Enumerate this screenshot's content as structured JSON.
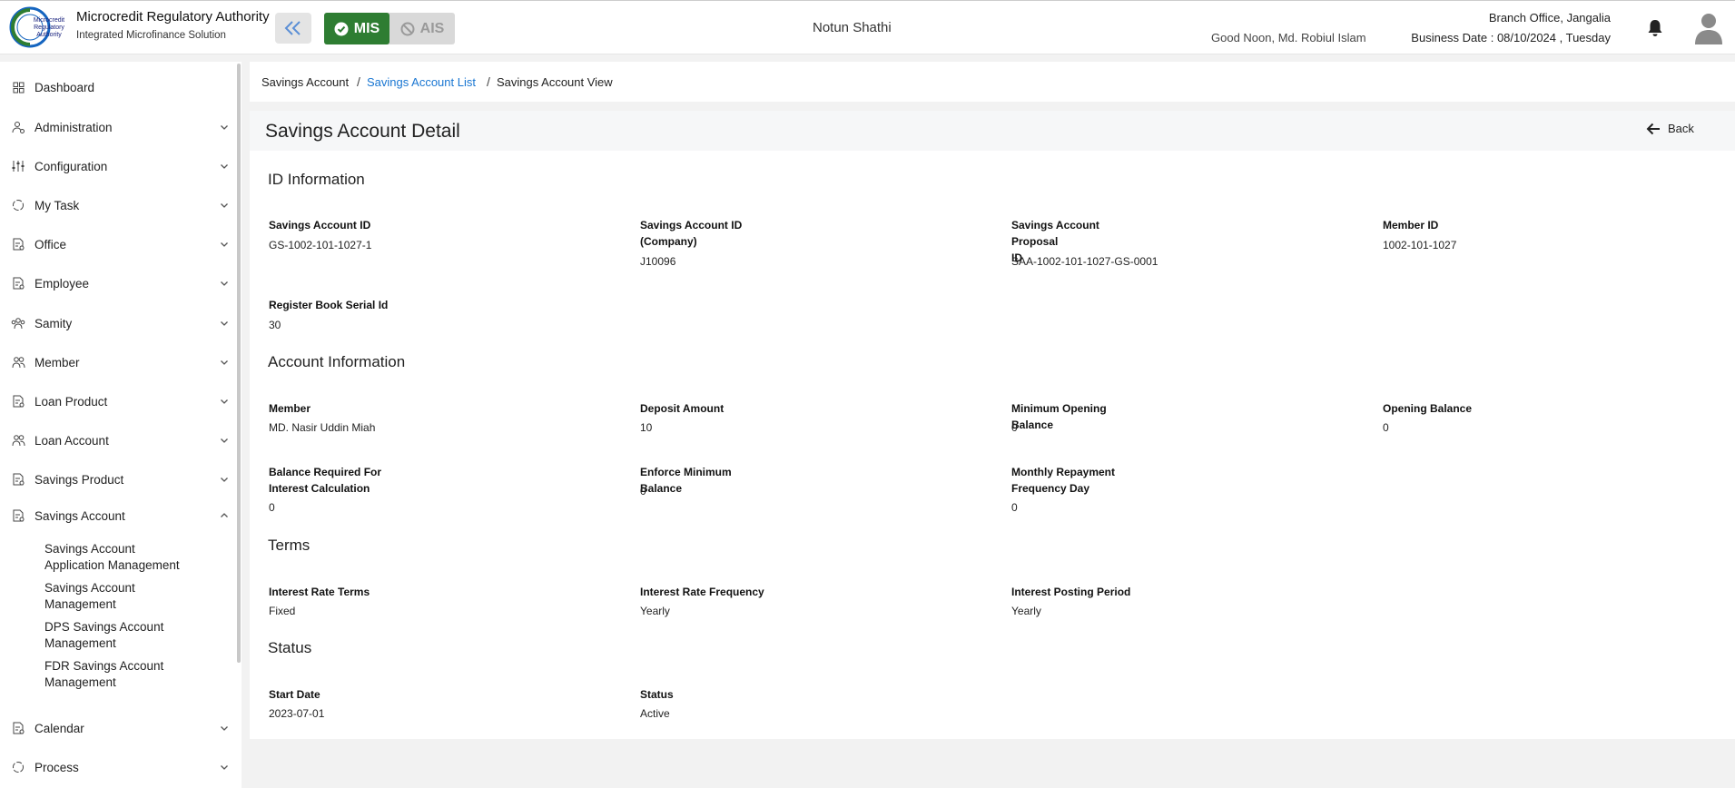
{
  "header": {
    "brand_title": "Microcredit Regulatory Authority",
    "brand_subtitle": "Integrated Microfinance Solution",
    "logo_text": "Microcredit Regulatory Authority",
    "org_name": "Notun Shathi",
    "greeting": "Good Noon, Md. Robiul Islam",
    "branch": "Branch Office, Jangalia",
    "business_date": "Business Date : 08/10/2024 , Tuesday",
    "systems": [
      {
        "label": "MIS",
        "active": true,
        "icon": "check-circle-icon"
      },
      {
        "label": "AIS",
        "active": false,
        "icon": "ban-icon"
      }
    ],
    "colors": {
      "mis_active": "#2e7d32",
      "link": "#1976d2"
    }
  },
  "sidebar": {
    "items": [
      {
        "label": "Dashboard",
        "icon": "grid-icon",
        "expandable": false
      },
      {
        "label": "Administration",
        "icon": "users-cog-icon",
        "expandable": true
      },
      {
        "label": "Configuration",
        "icon": "sliders-icon",
        "expandable": true
      },
      {
        "label": "My Task",
        "icon": "refresh-icon",
        "expandable": true
      },
      {
        "label": "Office",
        "icon": "document-icon",
        "expandable": true
      },
      {
        "label": "Employee",
        "icon": "document-icon",
        "expandable": true
      },
      {
        "label": "Samity",
        "icon": "group-icon",
        "expandable": true
      },
      {
        "label": "Member",
        "icon": "members-icon",
        "expandable": true
      },
      {
        "label": "Loan Product",
        "icon": "document-icon",
        "expandable": true
      },
      {
        "label": "Loan Account",
        "icon": "members-icon",
        "expandable": true
      },
      {
        "label": "Savings Product",
        "icon": "document-icon",
        "expandable": true
      },
      {
        "label": "Savings Account",
        "icon": "document-icon",
        "expandable": true,
        "expanded": true
      },
      {
        "label": "Calendar",
        "icon": "document-icon",
        "expandable": true
      },
      {
        "label": "Process",
        "icon": "refresh-icon",
        "expandable": true
      }
    ],
    "savings_account_subitems": [
      {
        "line1": "Savings Account",
        "line2": "Application Management"
      },
      {
        "line1": "Savings Account",
        "line2": "Management"
      },
      {
        "line1": "DPS Savings Account",
        "line2": "Management"
      },
      {
        "line1": "FDR Savings Account",
        "line2": "Management"
      }
    ]
  },
  "breadcrumb": {
    "items": [
      "Savings Account",
      "Savings Account List",
      "Savings Account View"
    ],
    "separator": "/"
  },
  "detail": {
    "title": "Savings Account Detail",
    "back_label": "Back",
    "sections": {
      "id_info": {
        "title": "ID Information",
        "fields": [
          {
            "label_lines": [
              "Savings Account ID"
            ],
            "value": "GS-1002-101-1027-1"
          },
          {
            "label_lines": [
              "Savings Account ID",
              "(Company)"
            ],
            "value": "J10096"
          },
          {
            "label_lines": [
              "Savings Account Proposal",
              "ID"
            ],
            "value": "SAA-1002-101-1027-GS-0001"
          },
          {
            "label_lines": [
              "Member ID"
            ],
            "value": "1002-101-1027"
          },
          {
            "label_lines": [
              "Register Book Serial Id"
            ],
            "value": "30"
          }
        ]
      },
      "account_info": {
        "title": "Account Information",
        "fields": [
          {
            "label_lines": [
              "Member"
            ],
            "value": "MD. Nasir Uddin Miah"
          },
          {
            "label_lines": [
              "Deposit Amount"
            ],
            "value": "10"
          },
          {
            "label_lines": [
              "Minimum Opening Balance"
            ],
            "value": "0"
          },
          {
            "label_lines": [
              "Opening Balance"
            ],
            "value": "0"
          },
          {
            "label_lines": [
              "Balance Required For",
              "Interest Calculation"
            ],
            "value": "0"
          },
          {
            "label_lines": [
              "Enforce Minimum Balance"
            ],
            "value": "0"
          },
          {
            "label_lines": [
              "Monthly Repayment",
              "Frequency Day"
            ],
            "value": "0"
          }
        ]
      },
      "terms": {
        "title": "Terms",
        "fields": [
          {
            "label_lines": [
              "Interest Rate Terms"
            ],
            "value": "Fixed"
          },
          {
            "label_lines": [
              "Interest Rate Frequency"
            ],
            "value": "Yearly"
          },
          {
            "label_lines": [
              "Interest Posting Period"
            ],
            "value": "Yearly"
          }
        ]
      },
      "status": {
        "title": "Status",
        "fields": [
          {
            "label_lines": [
              "Start Date"
            ],
            "value": "2023-07-01"
          },
          {
            "label_lines": [
              "Status"
            ],
            "value": "Active"
          }
        ]
      }
    }
  }
}
